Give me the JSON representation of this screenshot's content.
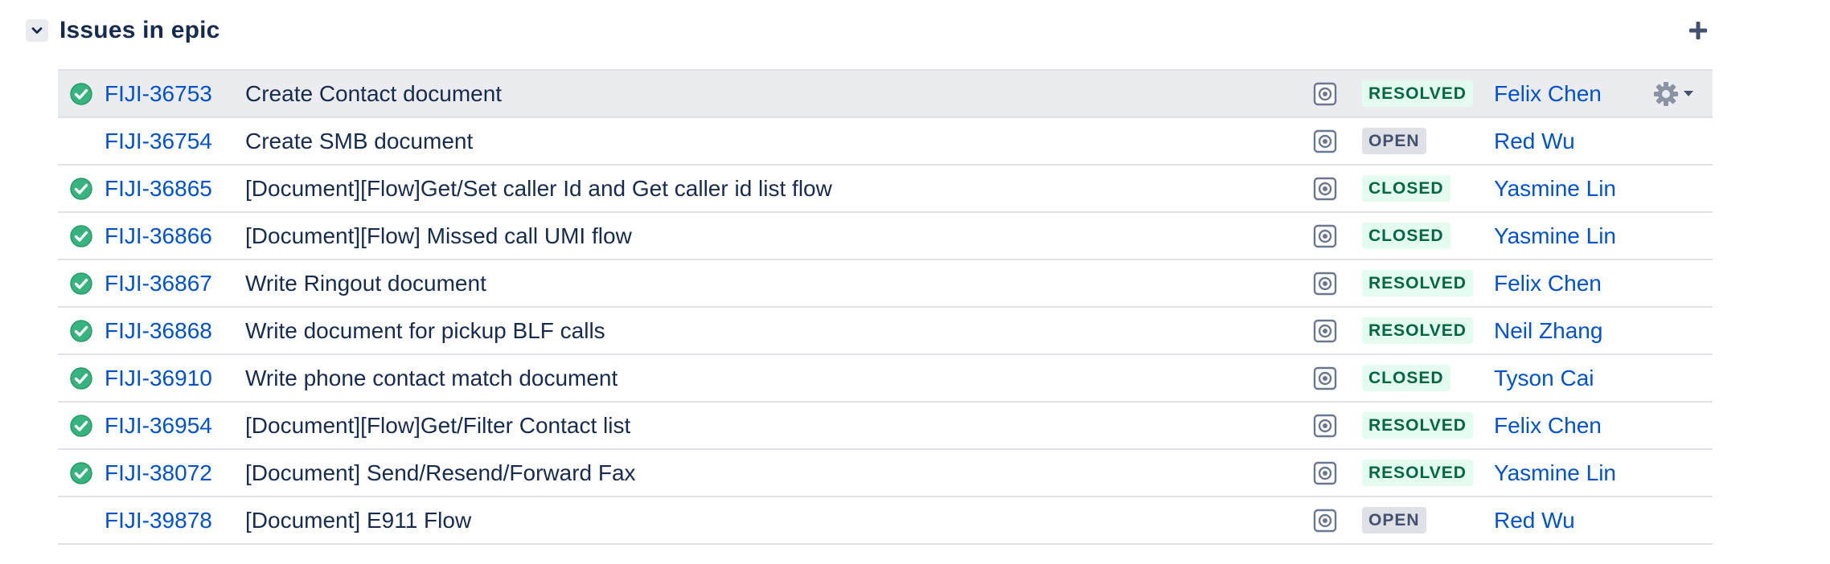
{
  "section": {
    "title": "Issues in epic"
  },
  "colors": {
    "link": "#0052cc",
    "resolved_check": "#36b37e",
    "lozenge_green_bg": "#e3fcef",
    "lozenge_green_text": "#006644",
    "lozenge_grey_bg": "#dfe1e6",
    "lozenge_grey_text": "#42526e",
    "row_highlight": "#ebecf0"
  },
  "icons": {
    "toggle": "chevron-down-icon",
    "add": "plus-icon",
    "done": "check-circle-icon",
    "issue_type": "task-icon",
    "actions": "gear-icon"
  },
  "issues": [
    {
      "key": "FIJI-36753",
      "summary": "Create Contact document",
      "status": "RESOLVED",
      "assignee": "Felix Chen",
      "done": true,
      "highlighted": true
    },
    {
      "key": "FIJI-36754",
      "summary": "Create SMB document",
      "status": "OPEN",
      "assignee": "Red Wu",
      "done": false,
      "highlighted": false
    },
    {
      "key": "FIJI-36865",
      "summary": "[Document][Flow]Get/Set caller Id and Get caller id list flow",
      "status": "CLOSED",
      "assignee": "Yasmine Lin",
      "done": true,
      "highlighted": false
    },
    {
      "key": "FIJI-36866",
      "summary": "[Document][Flow] Missed call UMI flow",
      "status": "CLOSED",
      "assignee": "Yasmine Lin",
      "done": true,
      "highlighted": false
    },
    {
      "key": "FIJI-36867",
      "summary": "Write Ringout document",
      "status": "RESOLVED",
      "assignee": "Felix Chen",
      "done": true,
      "highlighted": false
    },
    {
      "key": "FIJI-36868",
      "summary": "Write document for pickup BLF calls",
      "status": "RESOLVED",
      "assignee": "Neil Zhang",
      "done": true,
      "highlighted": false
    },
    {
      "key": "FIJI-36910",
      "summary": "Write phone contact match document",
      "status": "CLOSED",
      "assignee": "Tyson Cai",
      "done": true,
      "highlighted": false
    },
    {
      "key": "FIJI-36954",
      "summary": "[Document][Flow]Get/Filter Contact list",
      "status": "RESOLVED",
      "assignee": "Felix Chen",
      "done": true,
      "highlighted": false
    },
    {
      "key": "FIJI-38072",
      "summary": "[Document] Send/Resend/Forward Fax",
      "status": "RESOLVED",
      "assignee": "Yasmine Lin",
      "done": true,
      "highlighted": false
    },
    {
      "key": "FIJI-39878",
      "summary": "[Document] E911 Flow",
      "status": "OPEN",
      "assignee": "Red Wu",
      "done": false,
      "highlighted": false
    }
  ]
}
